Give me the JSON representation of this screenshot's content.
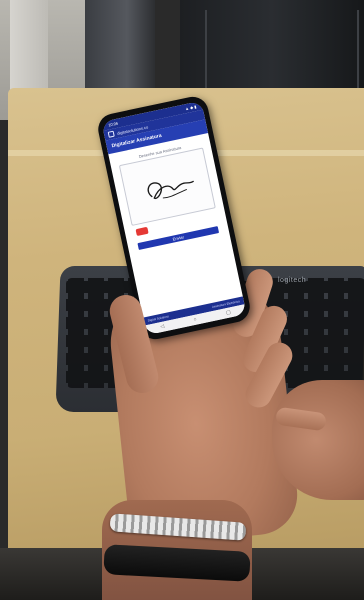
{
  "scene": {
    "description_tags": [
      "photo",
      "hand holding smartphone",
      "keyboard",
      "wooden table"
    ],
    "colors": {
      "app_primary": "#263fb3",
      "clear_button": "#e53935",
      "table_wood": "#cfb47c",
      "keyboard": "#2b2e33"
    }
  },
  "keyboard": {
    "brand": "logitech"
  },
  "phone": {
    "status": {
      "time": "10:06",
      "icons": "▲ ◆ ▮"
    },
    "url": "digitalsolutions.co",
    "app": {
      "header_title": "Digitalizar Assinatura",
      "signature_label": "Desenhe sua Assinatura",
      "submit_label": "Enviar",
      "footer_left": "Digital Solutions",
      "footer_right": "Assinatura Eletrônica"
    },
    "nav": {
      "back": "◁",
      "home": "○",
      "recent": "▢"
    }
  }
}
